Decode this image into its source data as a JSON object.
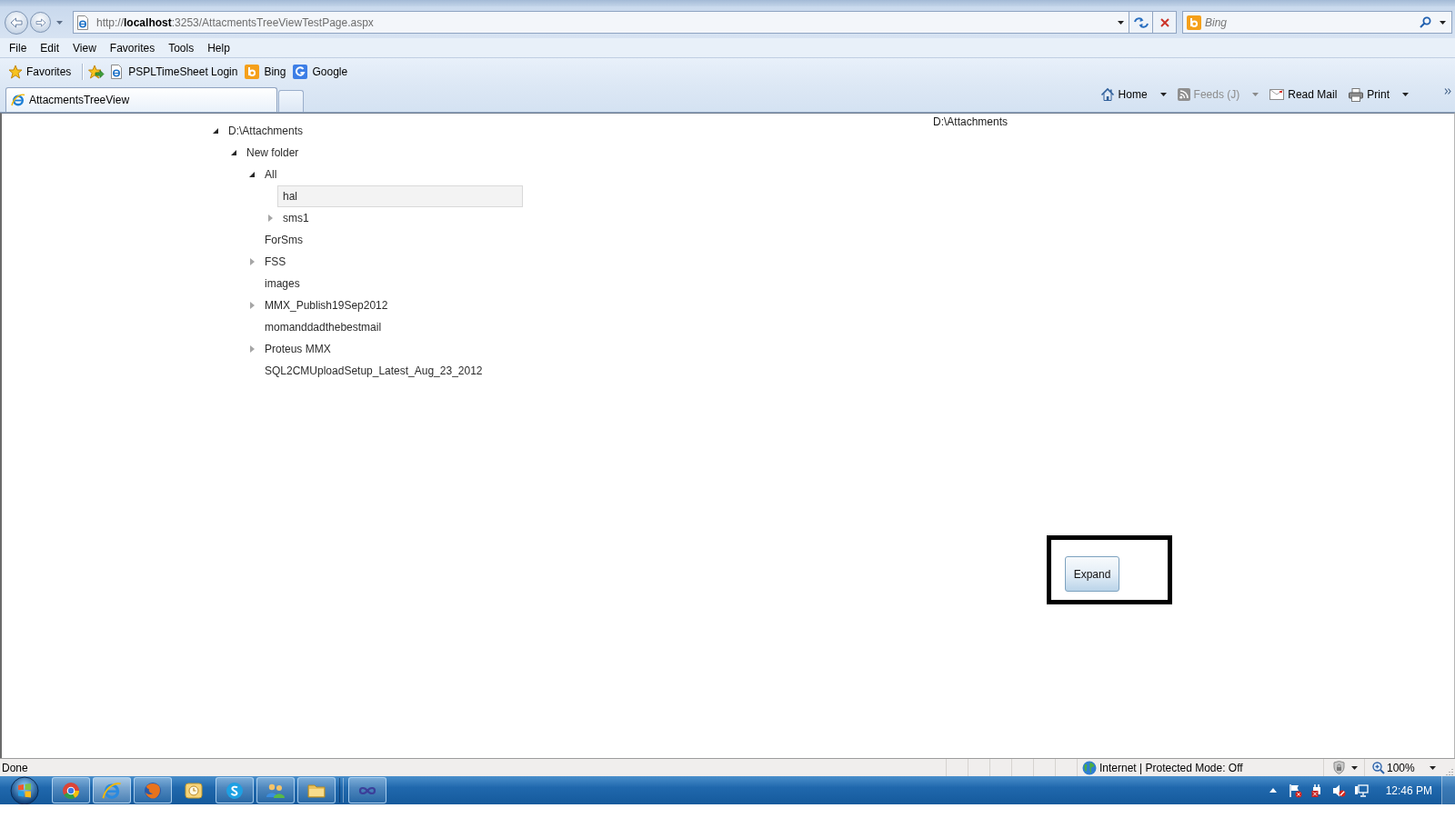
{
  "address_bar": {
    "url": "http://**localhost**:3253/AttacmentsTreeViewTestPage.aspx",
    "search_placeholder": "Bing"
  },
  "menu": [
    "File",
    "Edit",
    "View",
    "Favorites",
    "Tools",
    "Help"
  ],
  "favorites_bar": {
    "label": "Favorites",
    "links": [
      {
        "label": "PSPLTimeSheet Login",
        "kind": "page"
      },
      {
        "label": "Bing",
        "kind": "bing"
      },
      {
        "label": "Google",
        "kind": "google"
      }
    ]
  },
  "tabs": [
    {
      "label": "AttacmentsTreeView",
      "selected": true
    }
  ],
  "command_bar": [
    {
      "label": "Home",
      "kind": "home",
      "disabled": false,
      "menu": true
    },
    {
      "label": "Feeds (J)",
      "kind": "feeds",
      "disabled": true,
      "menu": true
    },
    {
      "label": "Read Mail",
      "kind": "mail",
      "disabled": false,
      "menu": false
    },
    {
      "label": "Print",
      "kind": "print",
      "disabled": false,
      "menu": true
    }
  ],
  "tree": [
    {
      "label": "D:\\Attachments",
      "expanded": true,
      "selected": false,
      "children": [
        {
          "label": "New folder",
          "expanded": true,
          "selected": false,
          "children": [
            {
              "label": "All",
              "expanded": true,
              "selected": false,
              "children": [
                {
                  "label": "hal",
                  "selected": true
                },
                {
                  "label": "sms1",
                  "expanded": false,
                  "selected": false
                }
              ]
            },
            {
              "label": "ForSms",
              "selected": false
            },
            {
              "label": "FSS",
              "expanded": false,
              "selected": false
            },
            {
              "label": "images",
              "selected": false
            },
            {
              "label": "MMX_Publish19Sep2012",
              "expanded": false,
              "selected": false
            },
            {
              "label": "momanddadthebestmail",
              "selected": false
            },
            {
              "label": "Proteus MMX",
              "expanded": false,
              "selected": false
            },
            {
              "label": "SQL2CMUploadSetup_Latest_Aug_23_2012",
              "selected": false
            }
          ]
        }
      ]
    }
  ],
  "detail": {
    "path": "D:\\Attachments",
    "button": "Expand"
  },
  "status_bar": {
    "text": "Done",
    "zone": "Internet | Protected Mode: Off",
    "zoom": "100%"
  },
  "taskbar": {
    "apps": [
      {
        "running": true,
        "selected": false
      },
      {
        "running": true,
        "selected": true
      },
      {
        "running": true,
        "selected": false
      },
      {
        "running": false,
        "selected": false
      },
      {
        "running": true,
        "selected": false
      },
      {
        "running": true,
        "selected": false
      },
      {
        "running": true,
        "selected": false
      },
      {
        "running": true,
        "selected": false
      }
    ],
    "clock": "12:46 PM"
  }
}
